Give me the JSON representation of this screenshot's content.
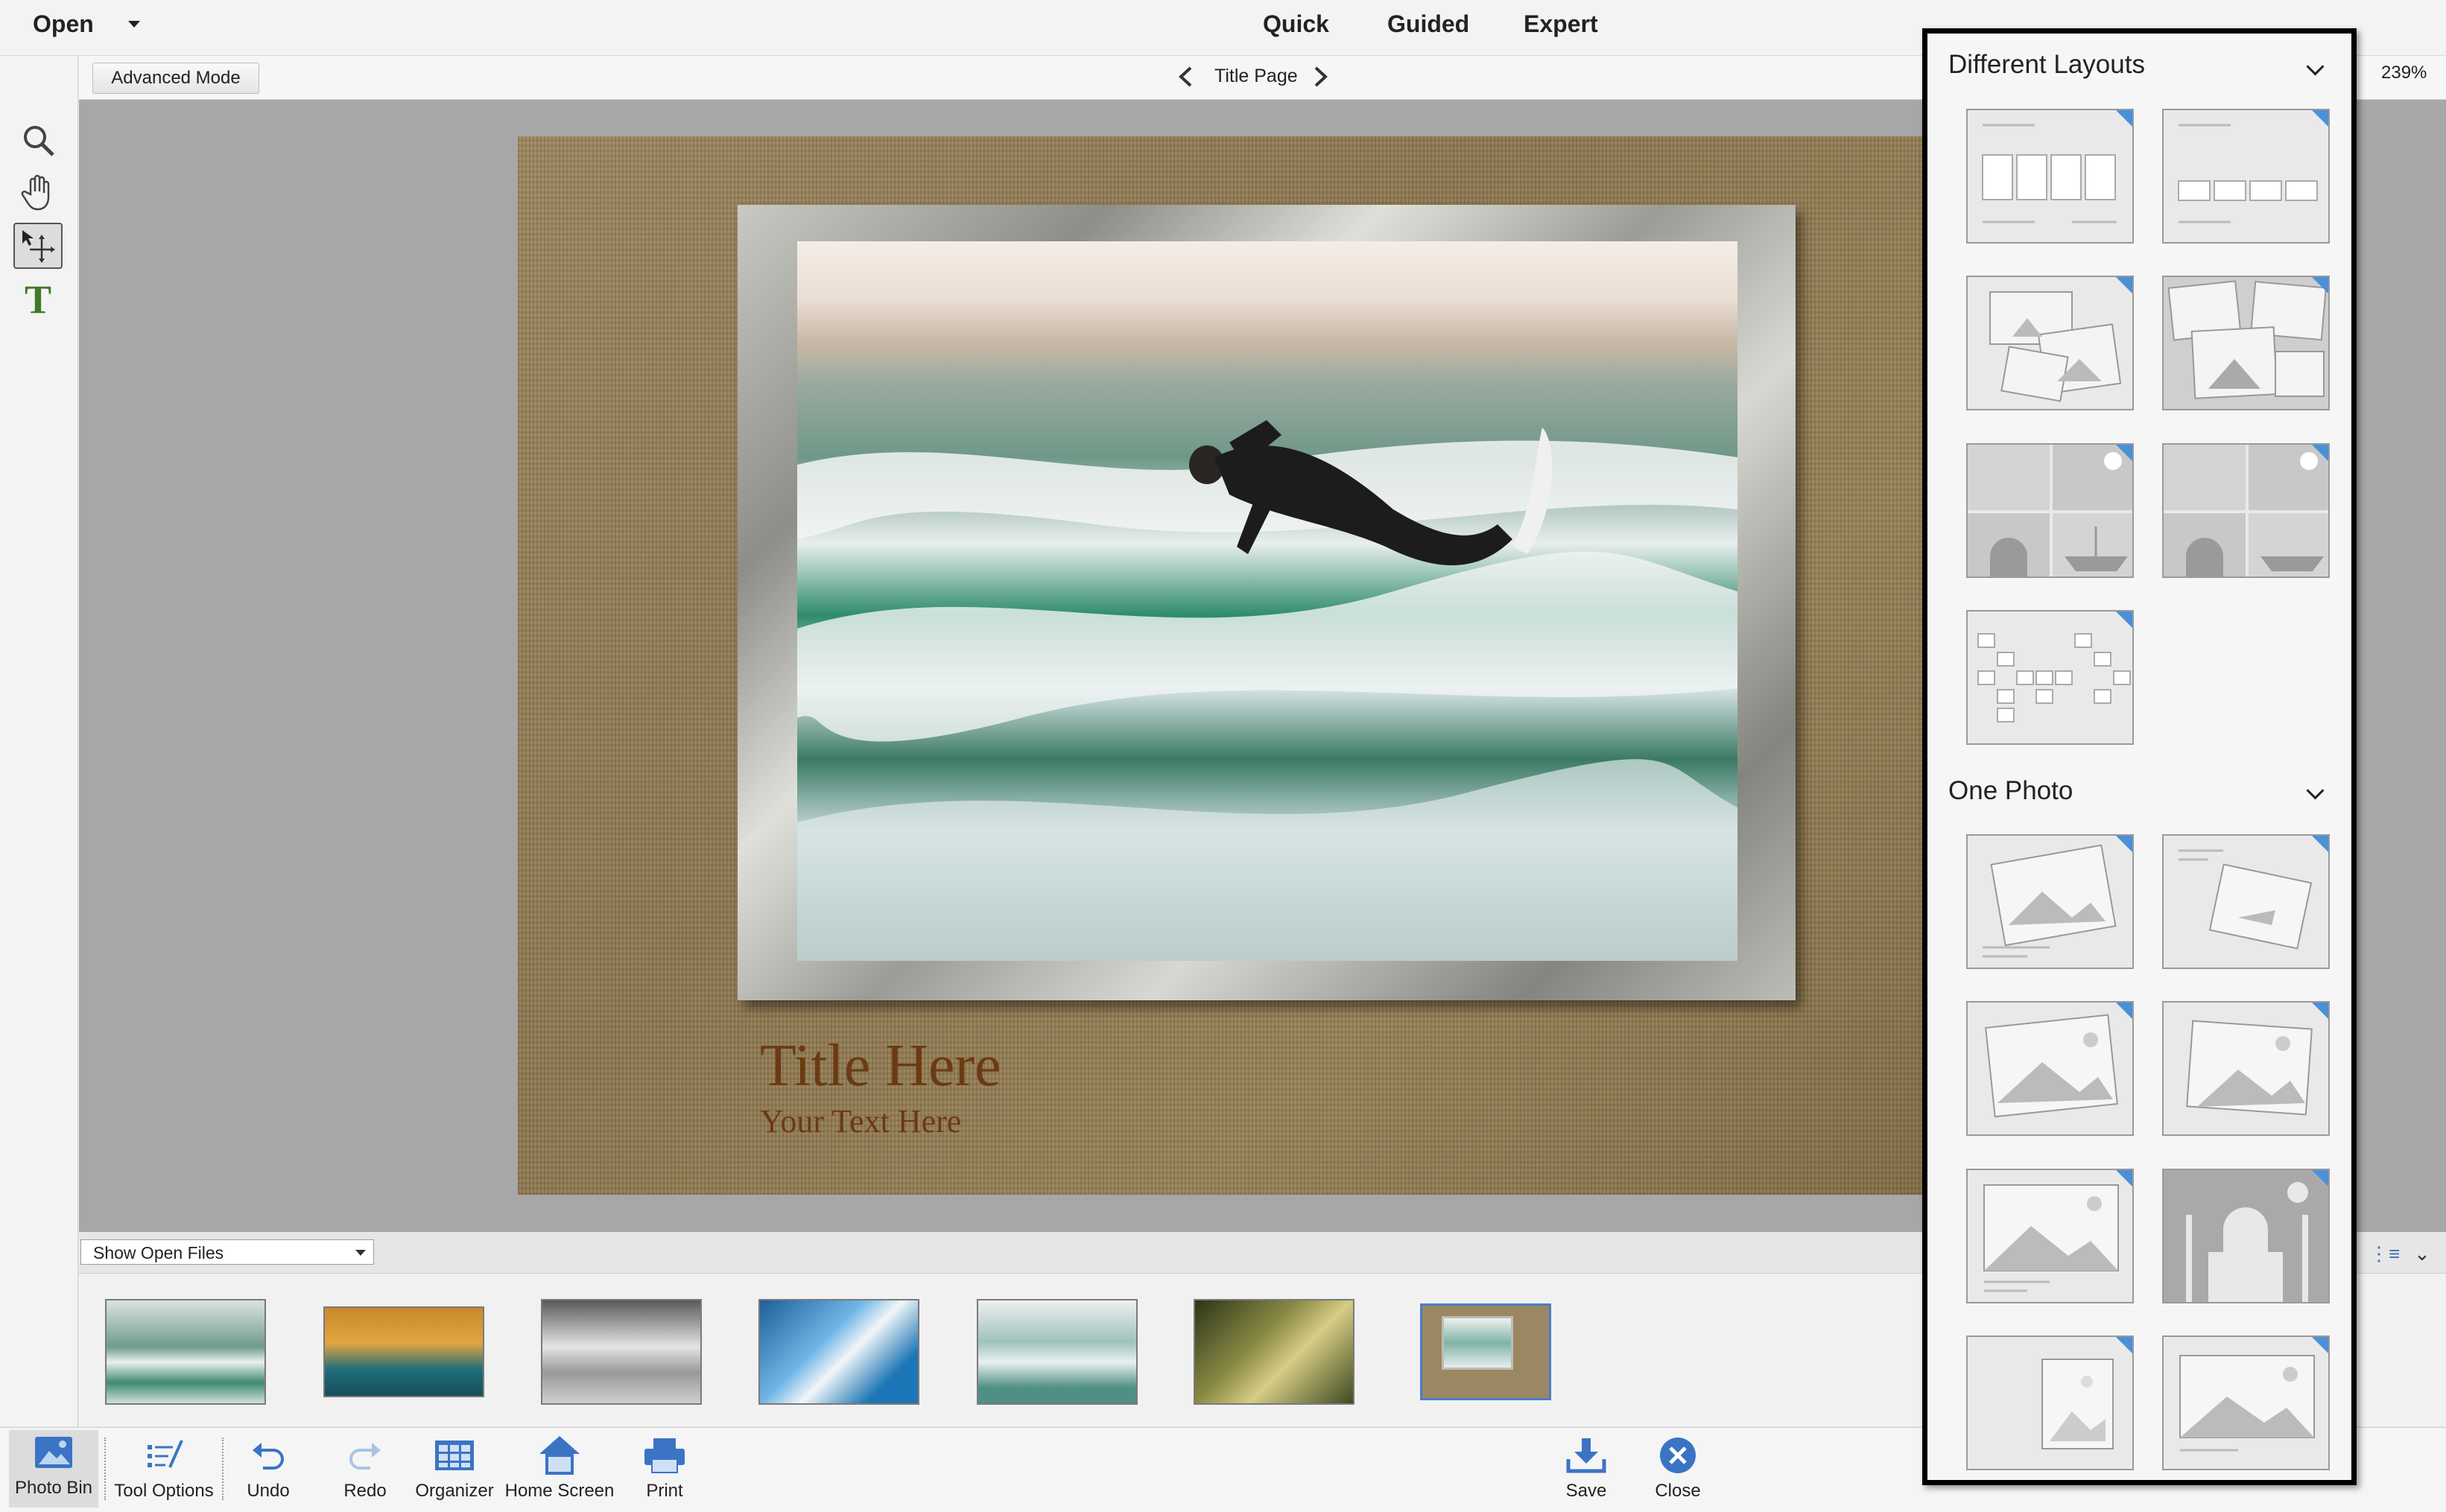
{
  "menu": {
    "open_label": "Open",
    "tabs": [
      "Quick",
      "Guided",
      "Expert"
    ]
  },
  "toolbar": {
    "advanced_mode_label": "Advanced Mode",
    "page_label": "Title Page",
    "zoom": "239%"
  },
  "tools": {
    "zoom": "zoom-icon",
    "hand": "hand-icon",
    "move": "move-icon",
    "text": "T"
  },
  "canvas": {
    "title": "Title Here",
    "subtitle": "Your Text Here"
  },
  "photo_bin": {
    "filter_value": "Show Open Files",
    "thumbnail_count": 7
  },
  "taskbar": {
    "photo_bin": "Photo Bin",
    "tool_options": "Tool Options",
    "undo": "Undo",
    "redo": "Redo",
    "organizer": "Organizer",
    "home_screen": "Home Screen",
    "print": "Print",
    "save": "Save",
    "close": "Close"
  },
  "layouts_panel": {
    "section_1": "Different Layouts",
    "section_2": "One Photo"
  },
  "colors": {
    "accent": "#4a90d9",
    "title_text": "#6b3a12",
    "text_tool": "#3f7a2a"
  }
}
